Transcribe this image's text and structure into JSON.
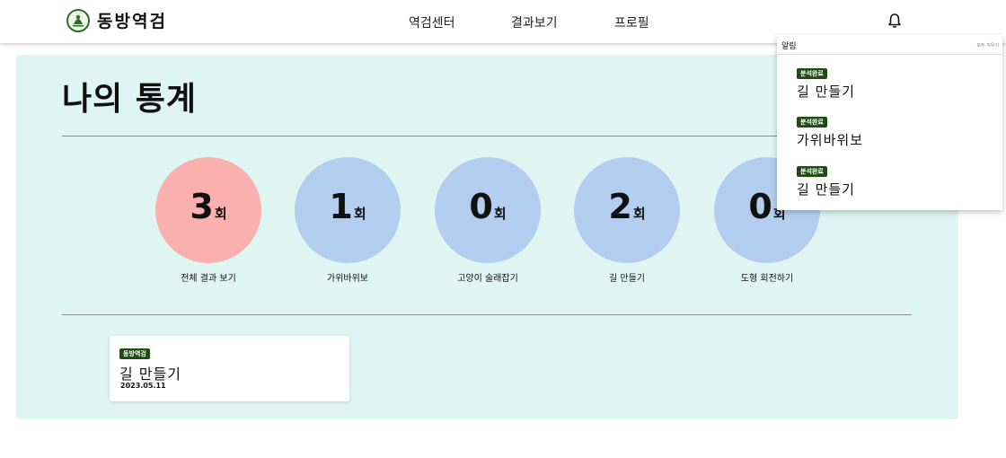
{
  "header": {
    "logo_text": "동방역검",
    "nav": [
      "역검센터",
      "결과보기",
      "프로필"
    ],
    "bell_icon": "bell-icon"
  },
  "main": {
    "title": "나의 통계",
    "stats": [
      {
        "count": "3",
        "unit": "회",
        "label": "전체 결과 보기",
        "color": "#fbb0b0"
      },
      {
        "count": "1",
        "unit": "회",
        "label": "가위바위보",
        "color": "#b3cdee"
      },
      {
        "count": "0",
        "unit": "회",
        "label": "고양이 술래잡기",
        "color": "#b3cdee"
      },
      {
        "count": "2",
        "unit": "회",
        "label": "길 만들기",
        "color": "#b3cdee"
      },
      {
        "count": "0",
        "unit": "회",
        "label": "도형 회전하기",
        "color": "#b3cdee"
      }
    ],
    "result_card": {
      "badge": "동방역검",
      "title": "길 만들기",
      "date": "2023.05.11"
    }
  },
  "notifications": {
    "title": "알림",
    "clear_all": "모두 지우기",
    "items": [
      {
        "badge": "분석완료",
        "title": "길 만들기"
      },
      {
        "badge": "분석완료",
        "title": "가위바위보"
      },
      {
        "badge": "분석완료",
        "title": "길 만들기"
      }
    ]
  },
  "colors": {
    "panel_bg": "#dff5f1",
    "badge_bg": "#1e4d12",
    "total_circle": "#fbb0b0",
    "game_circle": "#b3cdee"
  }
}
